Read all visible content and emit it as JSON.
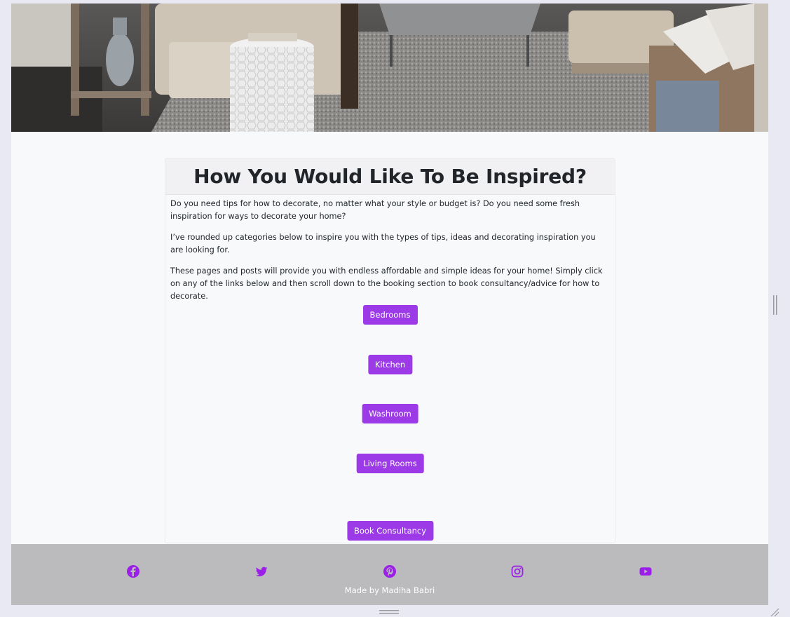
{
  "hero": {
    "alt": "Living room interior with armchairs, rug and coffee table"
  },
  "intro": {
    "title": "How You Would Like To Be Inspired?",
    "paragraphs": [
      "Do you need tips for how to decorate, no matter what your style or budget is? Do you need some fresh inspiration for ways to decorate your home?",
      "I’ve rounded up categories below to inspire you with the types of tips, ideas and decorating inspiration you are looking for.",
      "These pages and posts will provide you with endless affordable and simple ideas for your home! Simply click on any of the links below and then scroll down to the booking section to book consultancy/advice for how to decorate."
    ],
    "buttons": [
      "Bedrooms",
      "Kitchen",
      "Washroom",
      "Living Rooms",
      "Book Consultancy"
    ]
  },
  "footer": {
    "social": [
      "facebook-icon",
      "twitter-icon",
      "pinterest-icon",
      "instagram-icon",
      "youtube-icon"
    ],
    "credit": "Made by Madiha Babri"
  },
  "colors": {
    "accent": "#9b3ae6",
    "footer_bg": "#bbbbbd",
    "page_bg": "#f8f9fb"
  }
}
